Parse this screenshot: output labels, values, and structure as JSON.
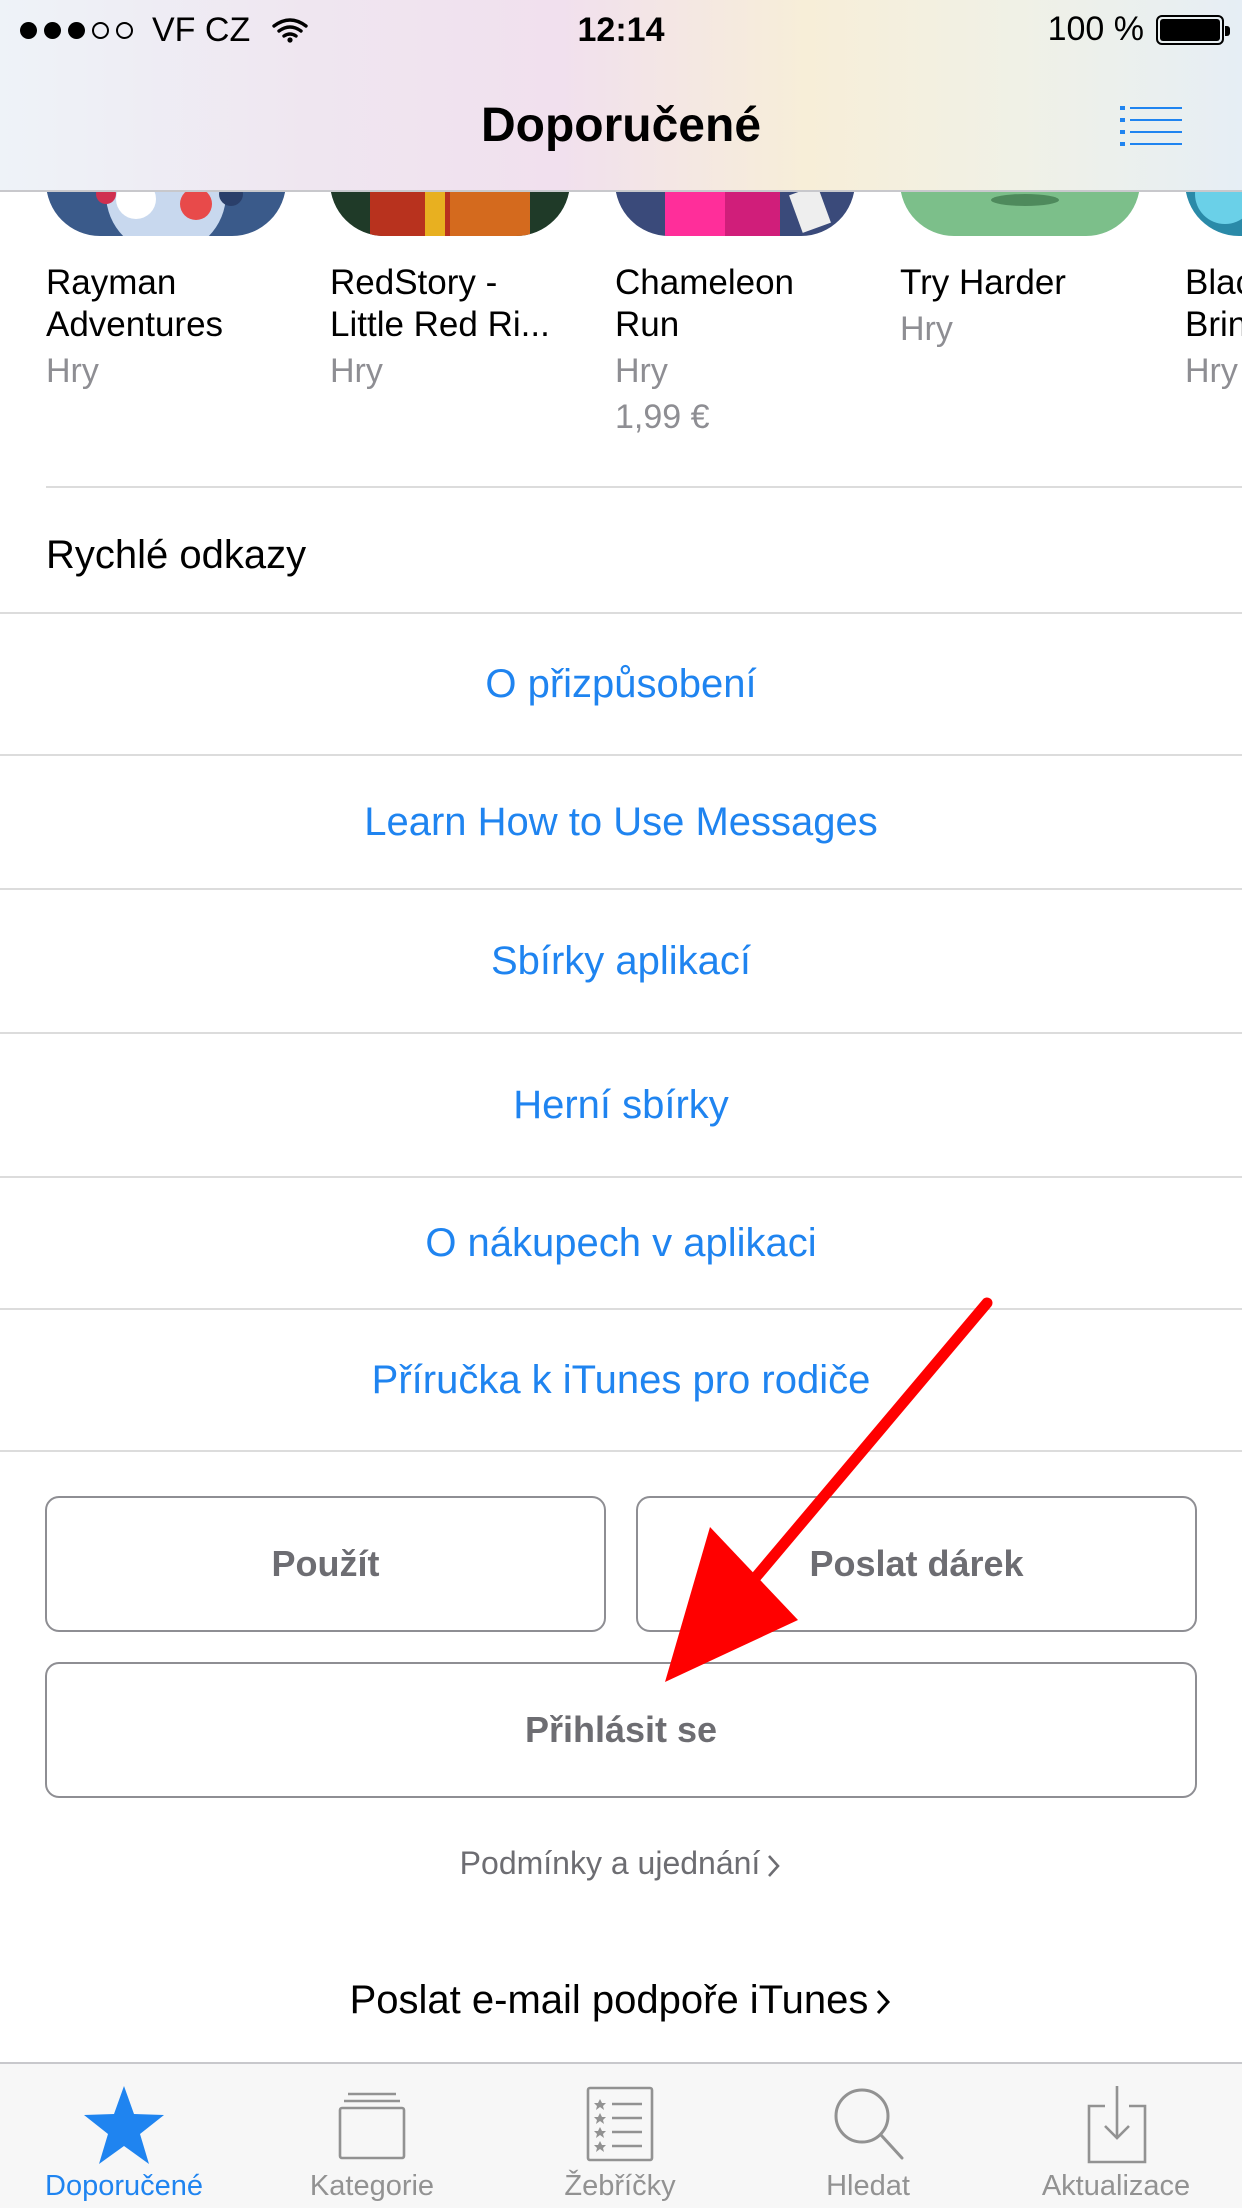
{
  "status_bar": {
    "carrier": "VF CZ",
    "time": "12:14",
    "battery": "100 %"
  },
  "nav": {
    "title": "Doporučené"
  },
  "apps": [
    {
      "name_line1": "Rayman",
      "name_line2": "Adventures",
      "category": "Hry",
      "price": ""
    },
    {
      "name_line1": "RedStory -",
      "name_line2": "Little Red Ri...",
      "category": "Hry",
      "price": ""
    },
    {
      "name_line1": "Chameleon",
      "name_line2": "Run",
      "category": "Hry",
      "price": "1,99 €"
    },
    {
      "name_line1": "Try Harder",
      "name_line2": "",
      "category": "Hry",
      "price": ""
    },
    {
      "name_line1": "Blac",
      "name_line2": "Brin",
      "category": "Hry",
      "price": ""
    }
  ],
  "quick_links": {
    "header": "Rychlé odkazy",
    "items": [
      "O přizpůsobení",
      "Learn How to Use Messages",
      "Sbírky aplikací",
      "Herní sbírky",
      "O nákupech v aplikaci",
      "Příručka k iTunes pro rodiče"
    ]
  },
  "buttons": {
    "redeem": "Použít",
    "send_gift": "Poslat dárek",
    "sign_in": "Přihlásit se"
  },
  "footer": {
    "terms": "Podmínky a ujednání",
    "support": "Poslat e-mail podpoře iTunes"
  },
  "tab_bar": {
    "items": [
      {
        "label": "Doporučené",
        "icon": "star-icon",
        "active": true
      },
      {
        "label": "Kategorie",
        "icon": "categories-icon",
        "active": false
      },
      {
        "label": "Žebříčky",
        "icon": "charts-list-icon",
        "active": false
      },
      {
        "label": "Hledat",
        "icon": "search-icon",
        "active": false
      },
      {
        "label": "Aktualizace",
        "icon": "updates-download-icon",
        "active": false
      }
    ]
  },
  "colors": {
    "accent": "#1f84f0",
    "annotation_arrow": "#ff0000",
    "secondary_text": "#8e8e93"
  }
}
